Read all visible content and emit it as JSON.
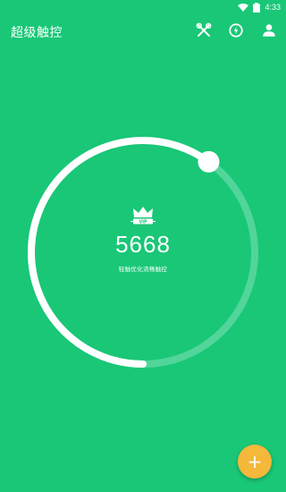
{
  "status_bar": {
    "time": "4:33",
    "icons": [
      "wifi-icon",
      "battery-icon"
    ]
  },
  "app_bar": {
    "title": "超级触控",
    "actions": [
      "tools-icon",
      "power-icon",
      "profile-icon"
    ]
  },
  "gauge": {
    "badge_text": "VIP",
    "score": "5668",
    "subtitle": "轻触优化流畅触控",
    "progress_fraction": 0.6
  },
  "fab": {
    "label": "+"
  },
  "colors": {
    "background": "#19c777",
    "ring_track": "#52d59b",
    "ring_fill": "#ffffff",
    "fab": "#f4b83a"
  }
}
